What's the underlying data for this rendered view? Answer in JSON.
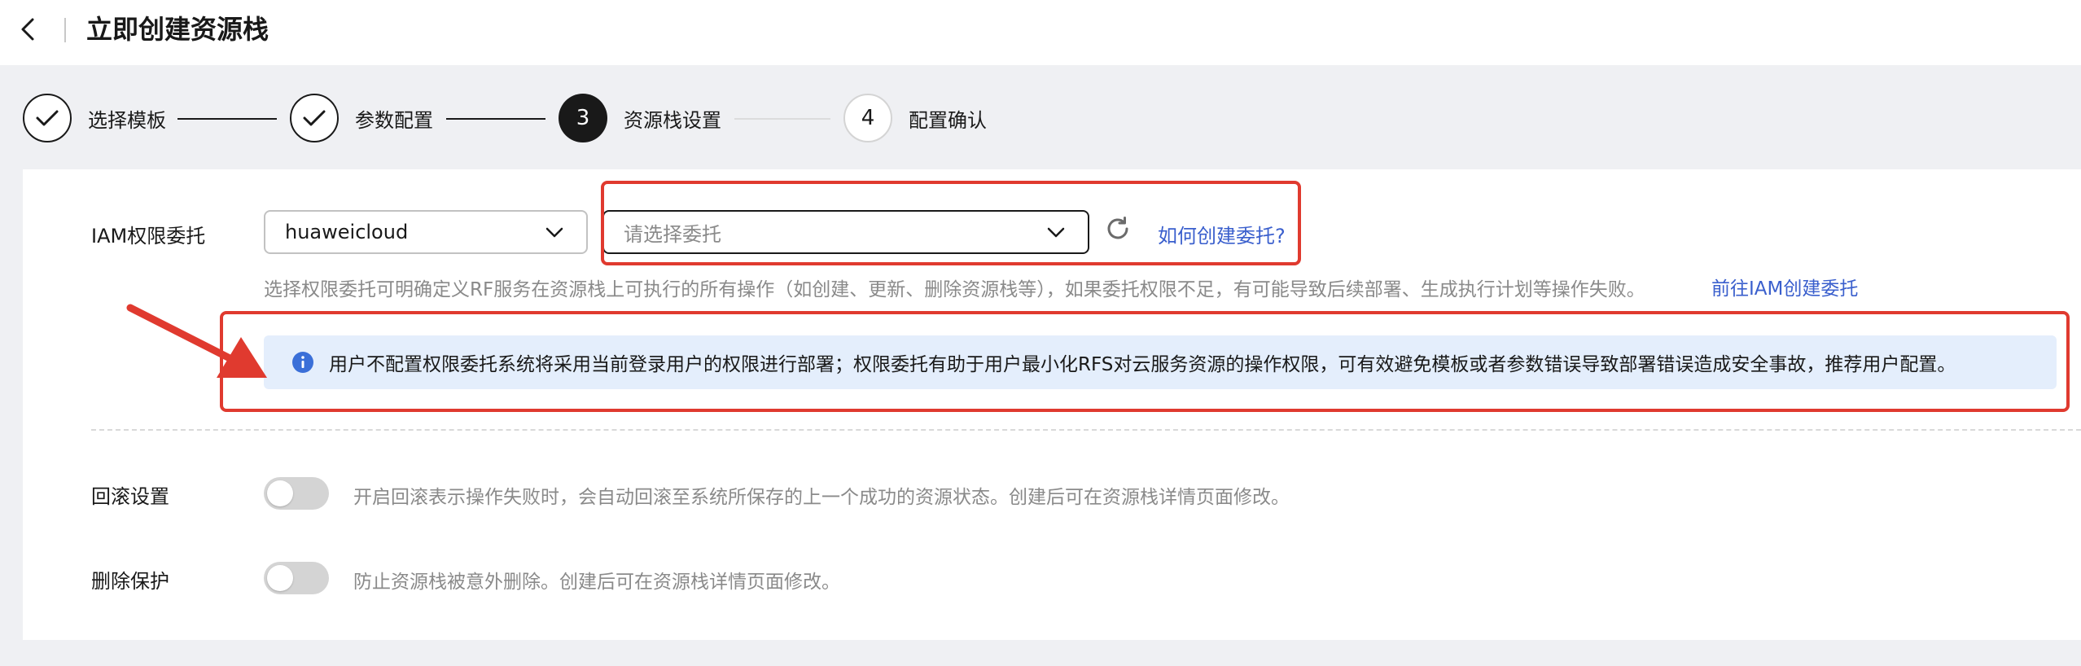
{
  "header": {
    "title": "立即创建资源栈"
  },
  "stepper": {
    "steps": [
      {
        "number": "1",
        "label": "选择模板",
        "state": "done"
      },
      {
        "number": "2",
        "label": "参数配置",
        "state": "done"
      },
      {
        "number": "3",
        "label": "资源栈设置",
        "state": "current"
      },
      {
        "number": "4",
        "label": "配置确认",
        "state": "todo"
      }
    ]
  },
  "iam": {
    "label": "IAM权限委托",
    "provider_value": "huaweicloud",
    "agency_placeholder": "请选择委托",
    "how_to_link": "如何创建委托?",
    "hint": "选择权限委托可明确定义RF服务在资源栈上可执行的所有操作（如创建、更新、删除资源栈等），如果委托权限不足，有可能导致后续部署、生成执行计划等操作失败。",
    "goto_link": "前往IAM创建委托",
    "info": "用户不配置权限委托系统将采用当前登录用户的权限进行部署；权限委托有助于用户最小化RFS对云服务资源的操作权限，可有效避免模板或者参数错误导致部署错误造成安全事故，推荐用户配置。"
  },
  "rollback": {
    "label": "回滚设置",
    "enabled": false,
    "description": "开启回滚表示操作失败时，会自动回滚至系统所保存的上一个成功的资源状态。创建后可在资源栈详情页面修改。"
  },
  "delete_protection": {
    "label": "删除保护",
    "enabled": false,
    "description": "防止资源栈被意外删除。创建后可在资源栈详情页面修改。"
  },
  "colors": {
    "accent_link": "#3a5fcd",
    "annotation_red": "#e03a2f",
    "info_bg": "#e4eefc",
    "info_icon": "#3a6fd8"
  },
  "icons": {
    "back": "chevron-left-icon",
    "check": "check-icon",
    "dropdown": "chevron-down-icon",
    "refresh": "refresh-icon",
    "info": "info-icon",
    "annotation": "red-arrow-icon"
  }
}
